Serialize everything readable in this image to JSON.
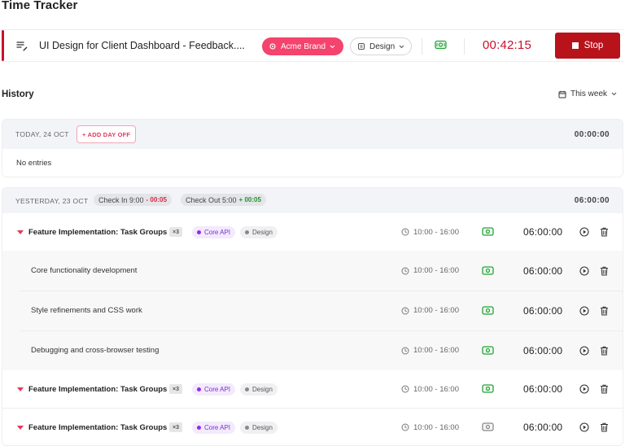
{
  "page": {
    "title": "Time Tracker"
  },
  "tracker": {
    "task_title": "UI Design for Client Dashboard - Feedback....",
    "client": "Acme Brand",
    "tag": "Design",
    "timer": "00:42:15",
    "stop_label": "Stop",
    "colors": {
      "accent": "#c8102e",
      "client_pill": "#f4436c",
      "stop": "#b8121b"
    }
  },
  "history": {
    "title": "History",
    "range": "This week"
  },
  "days": [
    {
      "date": "TODAY, 24 OCT",
      "add_day_off": "+ ADD DAY OFF",
      "total": "00:00:00",
      "empty_text": "No entries"
    },
    {
      "date": "YESTERDAY, 23 OCT",
      "check_in": {
        "label": "Check In 9:00",
        "delta": "- 00:05"
      },
      "check_out": {
        "label": "Check Out 5:00",
        "delta": "+ 00:05"
      },
      "total": "06:00:00",
      "groups": [
        {
          "name": "Feature Implementation: Task Groups",
          "count": "×3",
          "project": "Core API",
          "tag": "Design",
          "time_range": "10:00 - 16:00",
          "duration": "06:00:00",
          "billable": true,
          "subtasks": [
            {
              "name": "Core functionality development",
              "time_range": "10:00 - 16:00",
              "duration": "06:00:00",
              "billable": true
            },
            {
              "name": "Style refinements and CSS work",
              "time_range": "10:00 - 16:00",
              "duration": "06:00:00",
              "billable": true
            },
            {
              "name": "Debugging and cross-browser testing",
              "time_range": "10:00 - 16:00",
              "duration": "06:00:00",
              "billable": true
            }
          ]
        },
        {
          "name": "Feature Implementation: Task Groups",
          "count": "×3",
          "project": "Core API",
          "tag": "Design",
          "time_range": "10:00 - 16:00",
          "duration": "06:00:00",
          "billable": true
        },
        {
          "name": "Feature Implementation: Task Groups",
          "count": "×3",
          "project": "Core API",
          "tag": "Design",
          "time_range": "10:00 - 16:00",
          "duration": "06:00:00",
          "billable": false
        }
      ]
    }
  ],
  "icons": {
    "task_list": "list-edit-icon",
    "client": "gear-icon",
    "tag": "tag-icon",
    "billable": "money-icon",
    "calendar": "calendar-icon",
    "clock": "clock-icon",
    "play": "play-icon",
    "delete": "trash-icon"
  }
}
